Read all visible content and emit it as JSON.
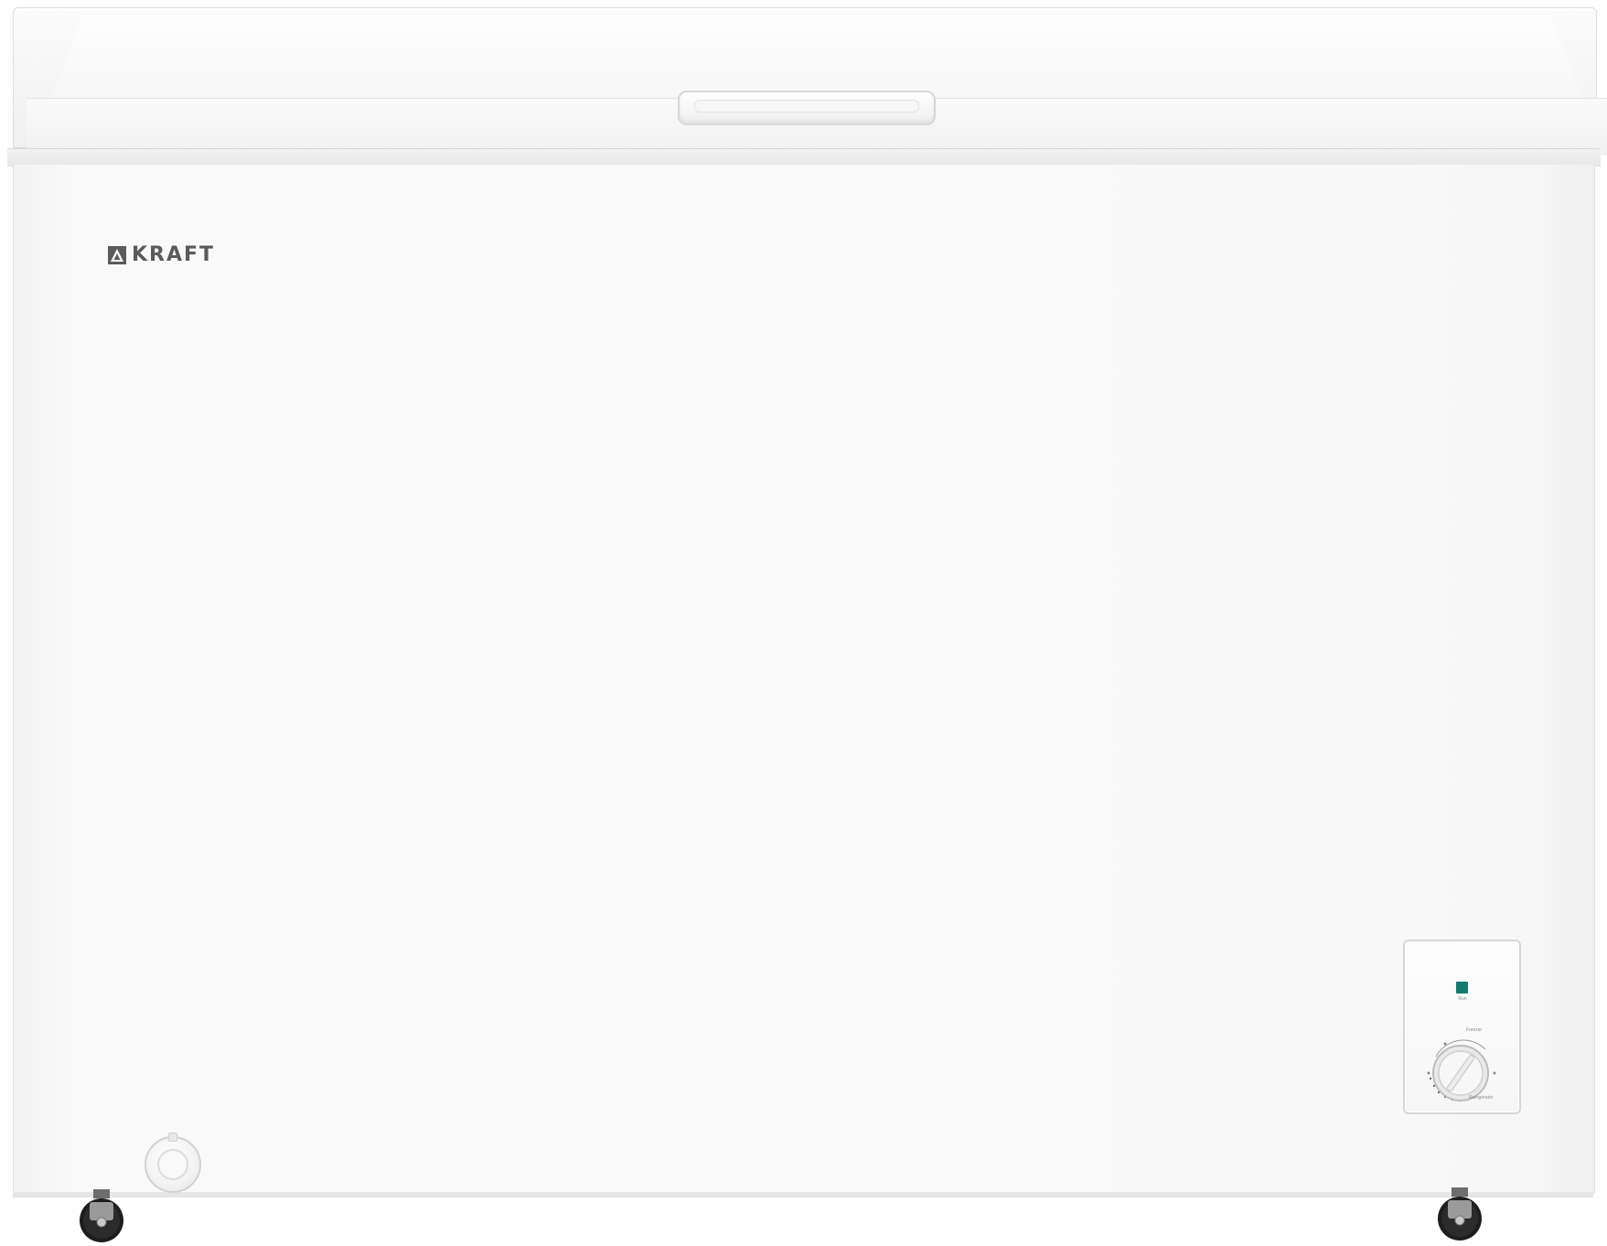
{
  "product": {
    "brand": "KRAFT",
    "body_color": "#fafafa",
    "logo_color": "#5a5a5a",
    "indicator_color": "#0f7c6e"
  },
  "control_panel": {
    "power_label": "Run",
    "freezer_label": "Freezer",
    "refrigerator_label": "Refrigerator"
  },
  "icons": [
    "kraft-logo-icon",
    "power-indicator-icon",
    "thermostat-dial-icon",
    "drain-plug-icon",
    "caster-wheel-icon"
  ]
}
